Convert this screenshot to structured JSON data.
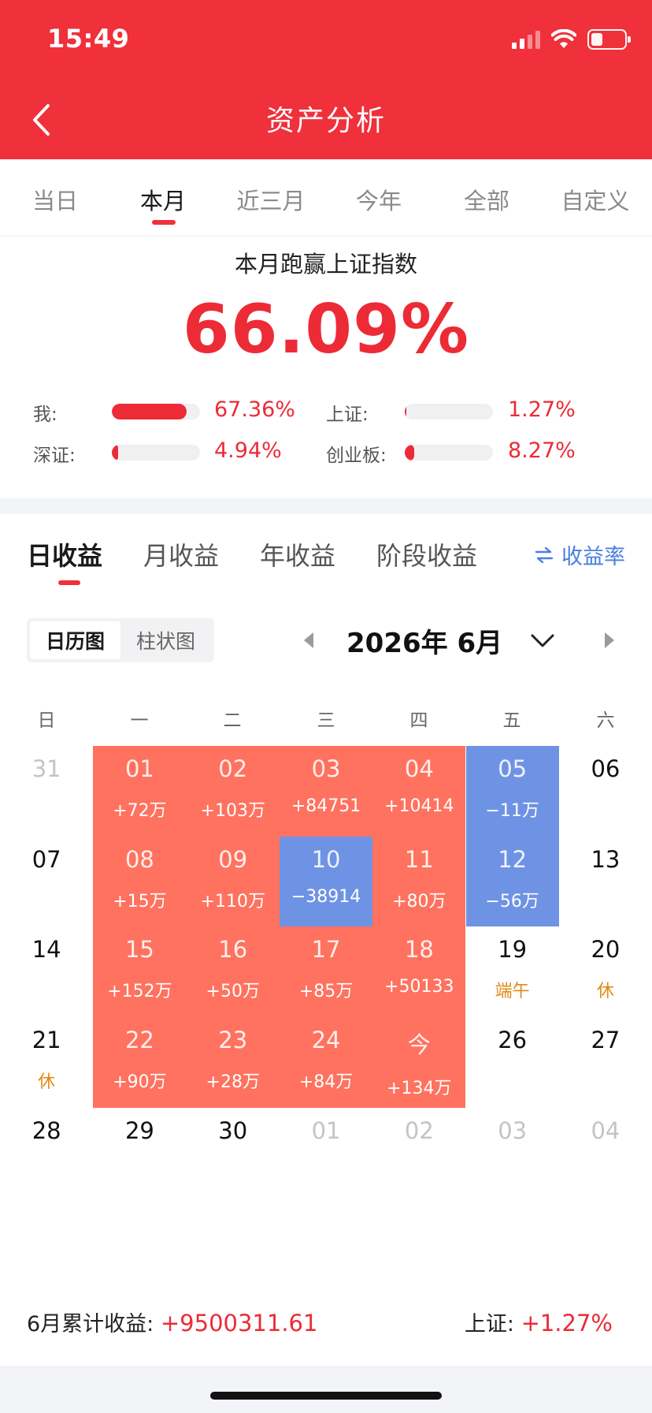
{
  "status": {
    "time": "15:49"
  },
  "header": {
    "title": "资产分析"
  },
  "period_tabs": [
    {
      "label": "当日"
    },
    {
      "label": "本月"
    },
    {
      "label": "近三月"
    },
    {
      "label": "今年"
    },
    {
      "label": "全部"
    },
    {
      "label": "自定义"
    }
  ],
  "period_active": "本月",
  "beat": {
    "title": "本月跑赢上证指数",
    "value": "66.09%",
    "comparisons": [
      {
        "label": "我:",
        "value": "67.36%",
        "fill_fraction": 0.85
      },
      {
        "label": "上证:",
        "value": "1.27%",
        "fill_fraction": 0.02
      },
      {
        "label": "深证:",
        "value": "4.94%",
        "fill_fraction": 0.07
      },
      {
        "label": "创业板:",
        "value": "8.27%",
        "fill_fraction": 0.11
      }
    ]
  },
  "earnings": {
    "tabs": [
      "日收益",
      "月收益",
      "年收益",
      "阶段收益"
    ],
    "active_tab": "日收益",
    "rate_link": "收益率",
    "view_options": [
      "日历图",
      "柱状图"
    ],
    "view_active": "日历图",
    "month_label": "2026年 6月",
    "weekdays": [
      "日",
      "一",
      "二",
      "三",
      "四",
      "五",
      "六"
    ],
    "calendar": [
      [
        {
          "day": "31",
          "sub": "",
          "state": "other"
        },
        {
          "day": "01",
          "sub": "+72万",
          "state": "up"
        },
        {
          "day": "02",
          "sub": "+103万",
          "state": "up"
        },
        {
          "day": "03",
          "sub": "+84751",
          "state": "up"
        },
        {
          "day": "04",
          "sub": "+10414",
          "state": "up"
        },
        {
          "day": "05",
          "sub": "−11万",
          "state": "down"
        },
        {
          "day": "06",
          "sub": "",
          "state": "normal"
        }
      ],
      [
        {
          "day": "07",
          "sub": "",
          "state": "normal"
        },
        {
          "day": "08",
          "sub": "+15万",
          "state": "up"
        },
        {
          "day": "09",
          "sub": "+110万",
          "state": "up"
        },
        {
          "day": "10",
          "sub": "−38914",
          "state": "down"
        },
        {
          "day": "11",
          "sub": "+80万",
          "state": "up"
        },
        {
          "day": "12",
          "sub": "−56万",
          "state": "down"
        },
        {
          "day": "13",
          "sub": "",
          "state": "normal"
        }
      ],
      [
        {
          "day": "14",
          "sub": "",
          "state": "normal"
        },
        {
          "day": "15",
          "sub": "+152万",
          "state": "up"
        },
        {
          "day": "16",
          "sub": "+50万",
          "state": "up"
        },
        {
          "day": "17",
          "sub": "+85万",
          "state": "up"
        },
        {
          "day": "18",
          "sub": "+50133",
          "state": "up"
        },
        {
          "day": "19",
          "sub": "端午",
          "state": "holiday"
        },
        {
          "day": "20",
          "sub": "休",
          "state": "holiday"
        }
      ],
      [
        {
          "day": "21",
          "sub": "休",
          "state": "holiday"
        },
        {
          "day": "22",
          "sub": "+90万",
          "state": "up"
        },
        {
          "day": "23",
          "sub": "+28万",
          "state": "up"
        },
        {
          "day": "24",
          "sub": "+84万",
          "state": "up"
        },
        {
          "day": "今",
          "sub": "+134万",
          "state": "up"
        },
        {
          "day": "26",
          "sub": "",
          "state": "normal"
        },
        {
          "day": "27",
          "sub": "",
          "state": "normal"
        }
      ],
      [
        {
          "day": "28",
          "sub": "",
          "state": "normal"
        },
        {
          "day": "29",
          "sub": "",
          "state": "normal"
        },
        {
          "day": "30",
          "sub": "",
          "state": "normal"
        },
        {
          "day": "01",
          "sub": "",
          "state": "other"
        },
        {
          "day": "02",
          "sub": "",
          "state": "other"
        },
        {
          "day": "03",
          "sub": "",
          "state": "other"
        },
        {
          "day": "04",
          "sub": "",
          "state": "other"
        }
      ]
    ],
    "summary": {
      "label": "6月累计收益:",
      "value": "+9500311.61",
      "index_label": "上证:",
      "index_value": "+1.27%"
    }
  },
  "colors": {
    "brand_red": "#f0303a",
    "gain": "#ff725f",
    "loss": "#6f93e4",
    "holiday": "#e08a17",
    "link_blue": "#4a7fe0"
  }
}
